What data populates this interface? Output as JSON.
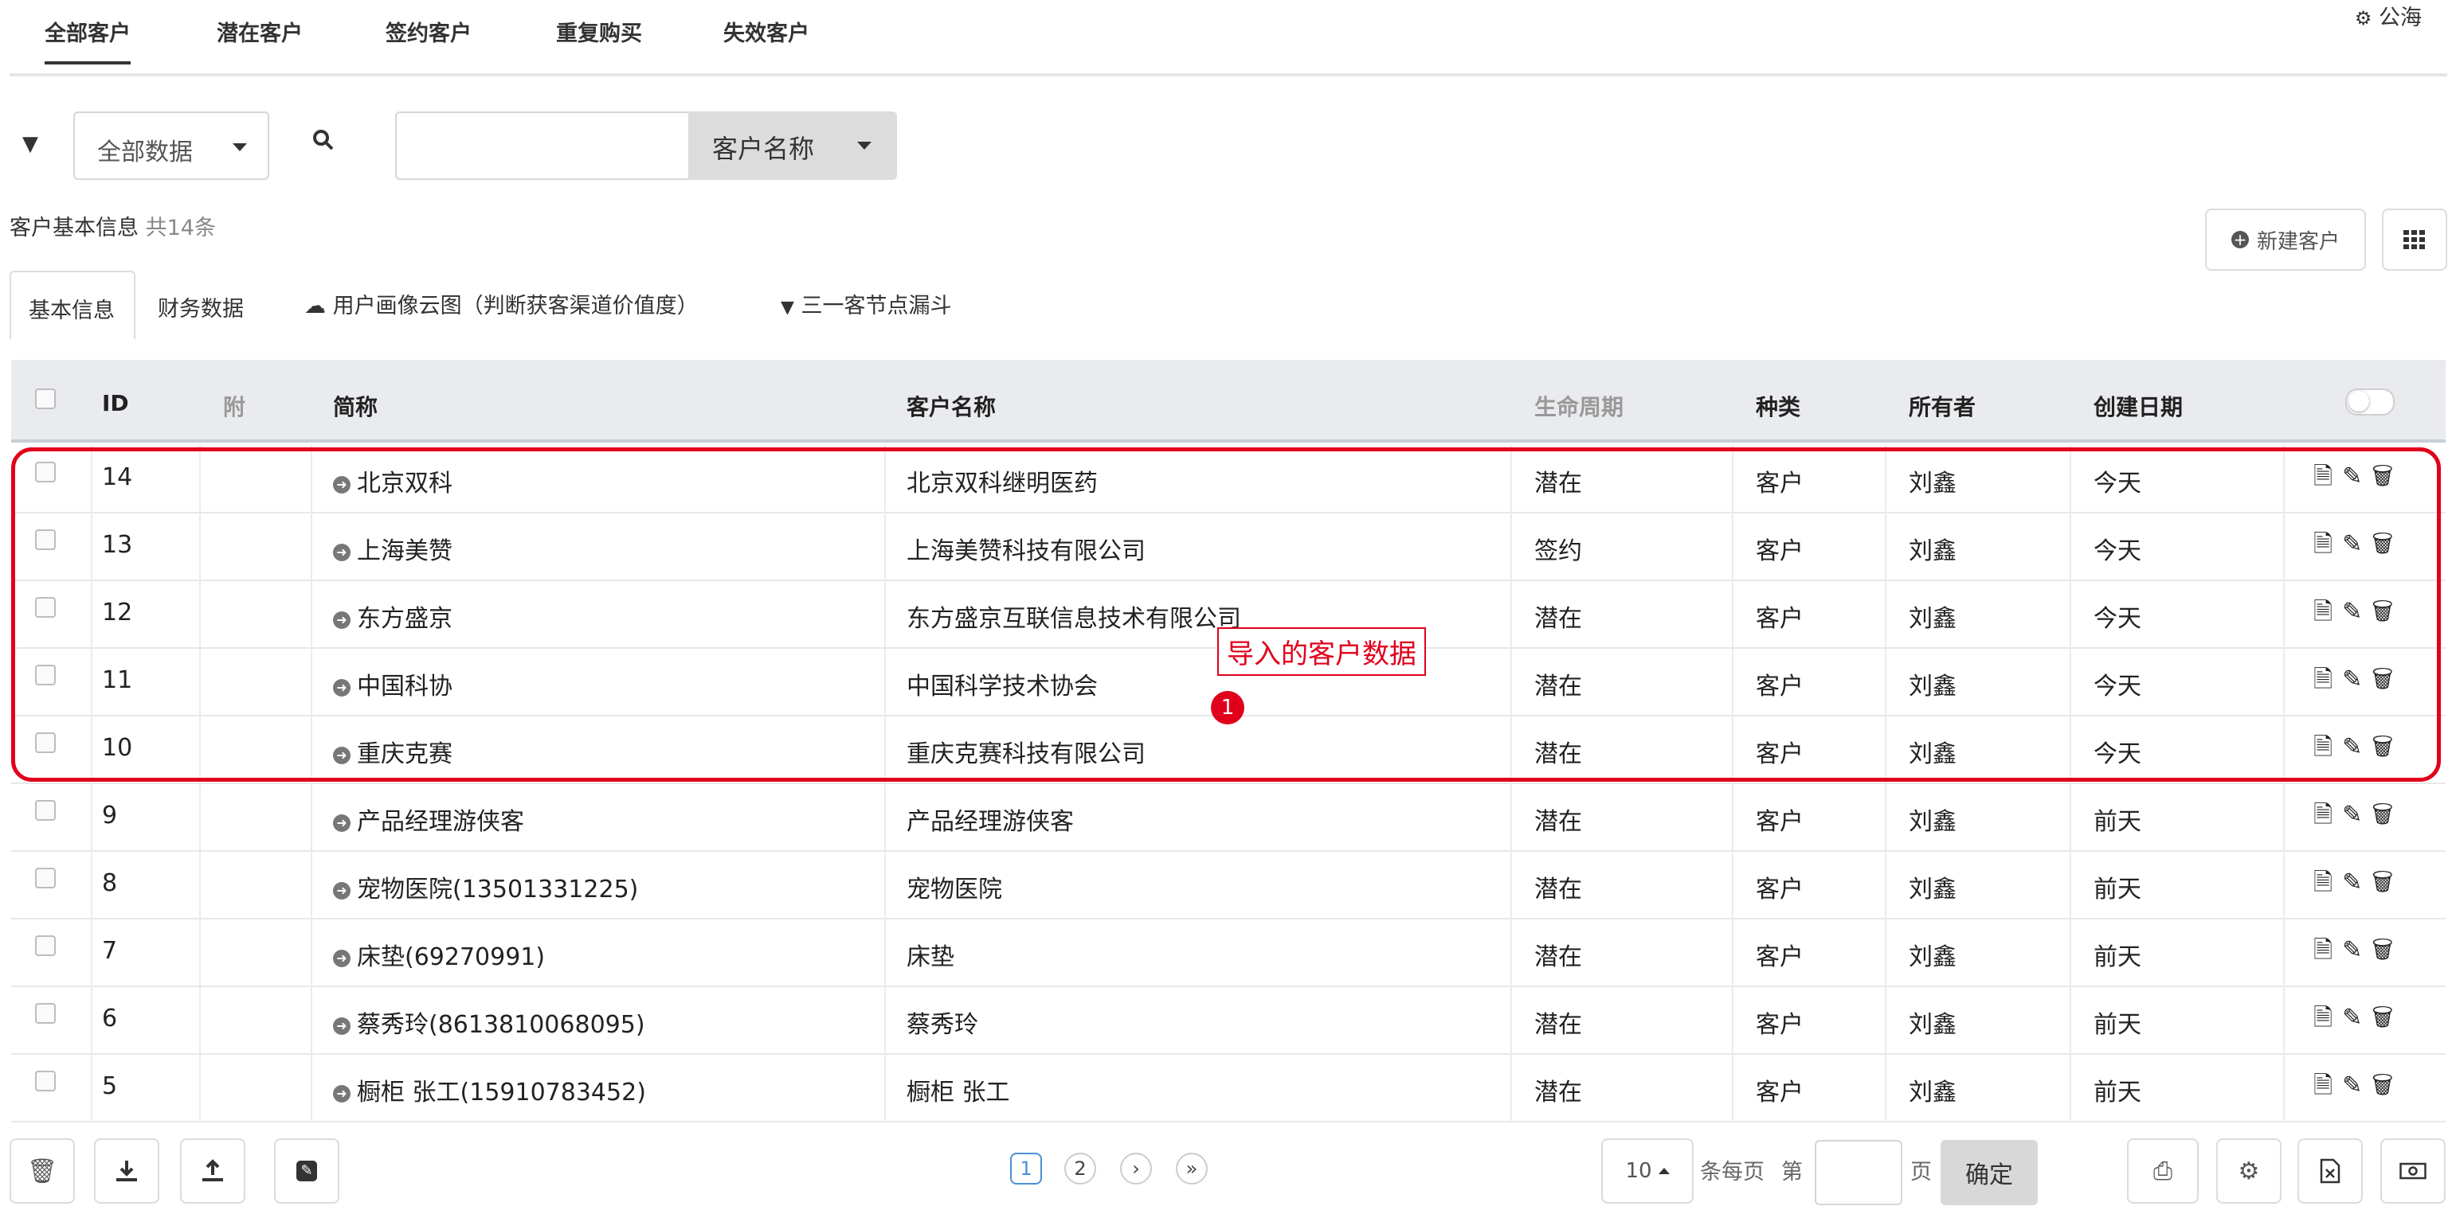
{
  "tabs": [
    "全部客户",
    "潜在客户",
    "签约客户",
    "重复购买",
    "失效客户"
  ],
  "gonghai": "公海",
  "filter": {
    "data_scope": "全部数据",
    "search_placeholder": "",
    "search_field": "客户名称"
  },
  "summary": {
    "label": "客户基本信息",
    "count": "共14条"
  },
  "buttons": {
    "new_customer": "新建客户"
  },
  "subtabs": [
    "基本信息",
    "财务数据",
    "用户画像云图（判断获客渠道价值度）",
    "三一客节点漏斗"
  ],
  "columns": [
    "ID",
    "附",
    "简称",
    "客户名称",
    "生命周期",
    "种类",
    "所有者",
    "创建日期"
  ],
  "rows": [
    {
      "id": "14",
      "short": "北京双科",
      "name": "北京双科继明医药",
      "stage": "潜在",
      "type": "客户",
      "owner": "刘鑫",
      "date": "今天"
    },
    {
      "id": "13",
      "short": "上海美赞",
      "name": "上海美赞科技有限公司",
      "stage": "签约",
      "type": "客户",
      "owner": "刘鑫",
      "date": "今天"
    },
    {
      "id": "12",
      "short": "东方盛京",
      "name": "东方盛京互联信息技术有限公司",
      "stage": "潜在",
      "type": "客户",
      "owner": "刘鑫",
      "date": "今天"
    },
    {
      "id": "11",
      "short": "中国科协",
      "name": "中国科学技术协会",
      "stage": "潜在",
      "type": "客户",
      "owner": "刘鑫",
      "date": "今天"
    },
    {
      "id": "10",
      "short": "重庆克赛",
      "name": "重庆克赛科技有限公司",
      "stage": "潜在",
      "type": "客户",
      "owner": "刘鑫",
      "date": "今天"
    },
    {
      "id": "9",
      "short": "产品经理游侠客",
      "name": "产品经理游侠客",
      "stage": "潜在",
      "type": "客户",
      "owner": "刘鑫",
      "date": "前天"
    },
    {
      "id": "8",
      "short": "宠物医院(13501331225)",
      "name": "宠物医院",
      "stage": "潜在",
      "type": "客户",
      "owner": "刘鑫",
      "date": "前天"
    },
    {
      "id": "7",
      "short": "床垫(69270991)",
      "name": "床垫",
      "stage": "潜在",
      "type": "客户",
      "owner": "刘鑫",
      "date": "前天"
    },
    {
      "id": "6",
      "short": "蔡秀玲(8613810068095)",
      "name": "蔡秀玲",
      "stage": "潜在",
      "type": "客户",
      "owner": "刘鑫",
      "date": "前天"
    },
    {
      "id": "5",
      "short": "橱柜 张工(15910783452)",
      "name": "橱柜 张工",
      "stage": "潜在",
      "type": "客户",
      "owner": "刘鑫",
      "date": "前天"
    }
  ],
  "annotation": {
    "text": "导入的客户数据",
    "badge": "1"
  },
  "pagination": {
    "pages": [
      "1",
      "2"
    ],
    "next": "›",
    "last": "»",
    "page_size": "10",
    "per_page_label": "条每页",
    "goto_prefix": "第",
    "goto_suffix": "页",
    "confirm": "确定"
  },
  "colors": {
    "annotation": "#e0001b",
    "header_bg": "#e9ebee",
    "active_page": "#4a90d9"
  }
}
